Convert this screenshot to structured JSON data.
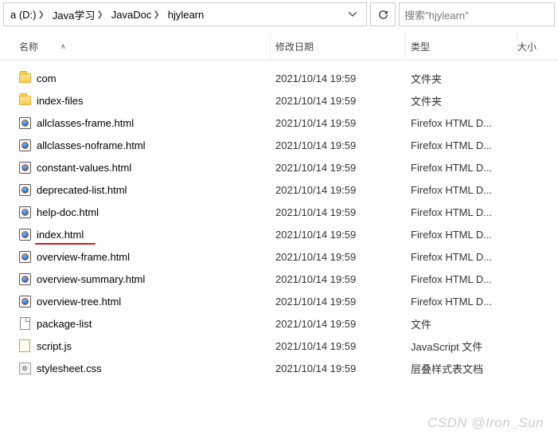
{
  "breadcrumb": {
    "items": [
      {
        "label": "a (D:)"
      },
      {
        "label": "Java学习"
      },
      {
        "label": "JavaDoc"
      },
      {
        "label": "hjylearn"
      }
    ]
  },
  "search": {
    "placeholder": "搜索\"hjylearn\""
  },
  "columns": {
    "name": "名称",
    "date": "修改日期",
    "type": "类型",
    "size": "大小"
  },
  "files": [
    {
      "icon": "folder",
      "name": "com",
      "date": "2021/10/14 19:59",
      "type": "文件夹",
      "underline": false
    },
    {
      "icon": "folder",
      "name": "index-files",
      "date": "2021/10/14 19:59",
      "type": "文件夹",
      "underline": false
    },
    {
      "icon": "ff",
      "name": "allclasses-frame.html",
      "date": "2021/10/14 19:59",
      "type": "Firefox HTML D...",
      "underline": false
    },
    {
      "icon": "ff",
      "name": "allclasses-noframe.html",
      "date": "2021/10/14 19:59",
      "type": "Firefox HTML D...",
      "underline": false
    },
    {
      "icon": "ff",
      "name": "constant-values.html",
      "date": "2021/10/14 19:59",
      "type": "Firefox HTML D...",
      "underline": false
    },
    {
      "icon": "ff",
      "name": "deprecated-list.html",
      "date": "2021/10/14 19:59",
      "type": "Firefox HTML D...",
      "underline": false
    },
    {
      "icon": "ff",
      "name": "help-doc.html",
      "date": "2021/10/14 19:59",
      "type": "Firefox HTML D...",
      "underline": false
    },
    {
      "icon": "ff",
      "name": "index.html",
      "date": "2021/10/14 19:59",
      "type": "Firefox HTML D...",
      "underline": true,
      "uw": 76
    },
    {
      "icon": "ff",
      "name": "overview-frame.html",
      "date": "2021/10/14 19:59",
      "type": "Firefox HTML D...",
      "underline": false
    },
    {
      "icon": "ff",
      "name": "overview-summary.html",
      "date": "2021/10/14 19:59",
      "type": "Firefox HTML D...",
      "underline": false
    },
    {
      "icon": "ff",
      "name": "overview-tree.html",
      "date": "2021/10/14 19:59",
      "type": "Firefox HTML D...",
      "underline": false
    },
    {
      "icon": "file",
      "name": "package-list",
      "date": "2021/10/14 19:59",
      "type": "文件",
      "underline": false
    },
    {
      "icon": "js",
      "name": "script.js",
      "date": "2021/10/14 19:59",
      "type": "JavaScript 文件",
      "underline": false
    },
    {
      "icon": "css",
      "name": "stylesheet.css",
      "date": "2021/10/14 19:59",
      "type": "层叠样式表文档",
      "underline": false
    }
  ],
  "watermark": "CSDN @Iron_Sun"
}
